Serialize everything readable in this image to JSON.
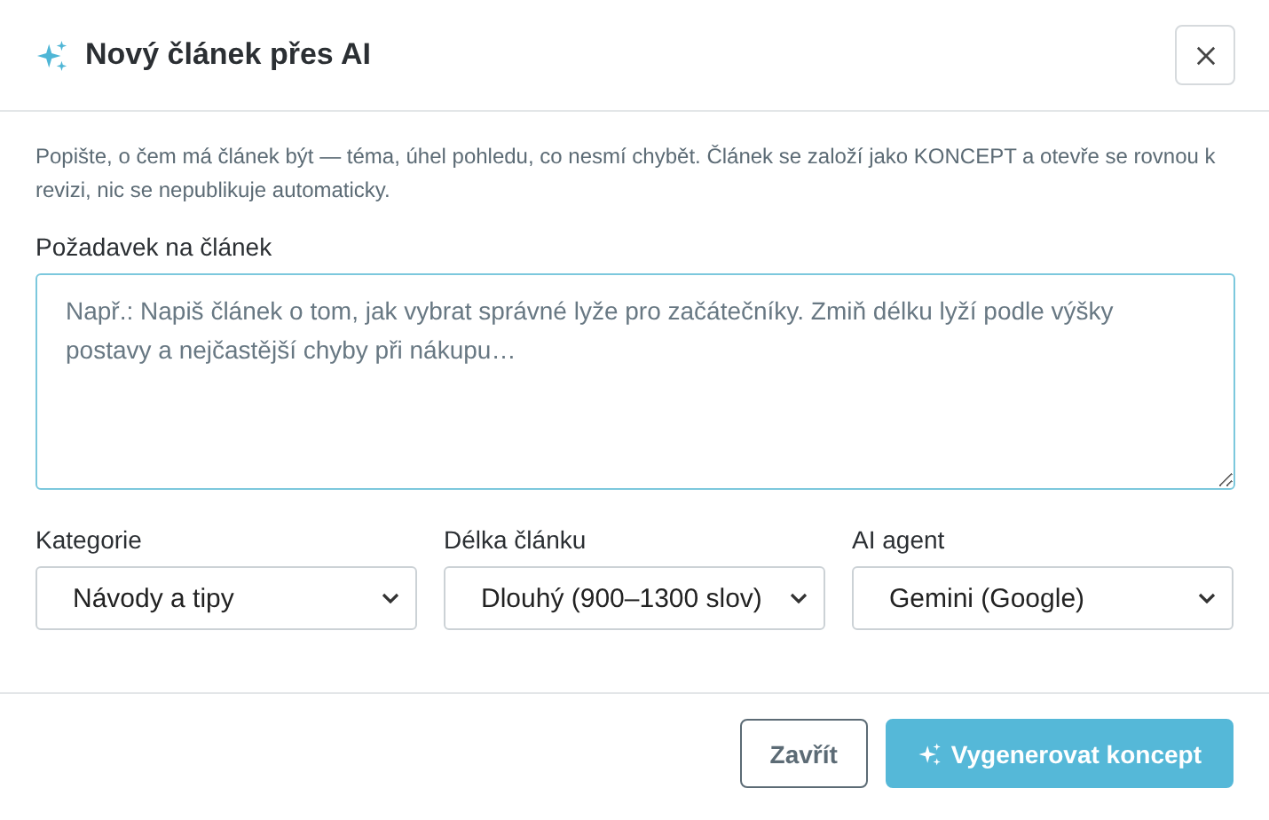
{
  "dialog": {
    "title": "Nový článek přes AI"
  },
  "description": "Popište, o čem má článek být — téma, úhel pohledu, co nesmí chybět. Článek se založí jako KONCEPT a otevře se rovnou k revizi, nic se nepublikuje automaticky.",
  "request": {
    "label": "Požadavek na článek",
    "placeholder": "Např.: Napiš článek o tom, jak vybrat správné lyže pro začátečníky. Zmiň délku lyží podle výšky postavy a nejčastější chyby při nákupu…"
  },
  "selects": [
    {
      "label": "Kategorie",
      "value": "Návody a tipy"
    },
    {
      "label": "Délka článku",
      "value": "Dlouhý (900–1300 slov)"
    },
    {
      "label": "AI agent",
      "value": "Gemini (Google)"
    }
  ],
  "buttons": [
    {
      "kind": "secondary",
      "label": "Zavřít"
    },
    {
      "kind": "primary",
      "label": "Vygenerovat koncept"
    }
  ]
}
